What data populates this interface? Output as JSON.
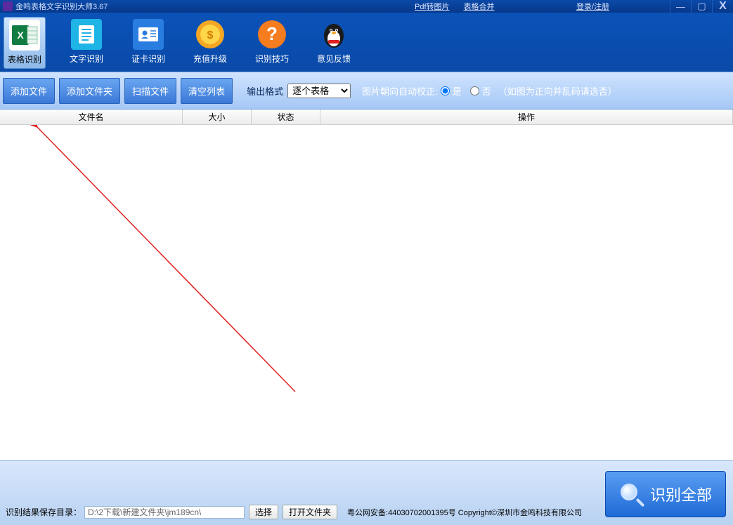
{
  "titlebar": {
    "title": "金鸣表格文字识别大师3.67",
    "links": {
      "pdf2img": "Pdf转图片",
      "merge": "表格合并",
      "login": "登录/注册"
    },
    "win": {
      "min": "—",
      "max": "▢",
      "close": "X"
    }
  },
  "main_tools": [
    {
      "label": "表格识别"
    },
    {
      "label": "文字识别"
    },
    {
      "label": "证卡识别"
    },
    {
      "label": "充值升级"
    },
    {
      "label": "识别技巧"
    },
    {
      "label": "意见反馈"
    }
  ],
  "action": {
    "add_file": "添加文件",
    "add_folder": "添加文件夹",
    "scan": "扫描文件",
    "clear": "清空列表",
    "output_label": "输出格式",
    "output_value": "逐个表格",
    "orient_label": "图片朝向自动校正:",
    "yes": "是",
    "no": "否",
    "hint": "（如图为正向并乱码请选否）"
  },
  "columns": {
    "name": "文件名",
    "size": "大小",
    "status": "状态",
    "op": "操作"
  },
  "bottom": {
    "save_label": "识别结果保存目录：",
    "save_path": "D:\\2下载\\新建文件夹\\jm189cn\\",
    "choose": "选择",
    "open_folder": "打开文件夹",
    "copyright": "粤公网安备:44030702001395号 Copyright©深圳市金鸣科技有限公司",
    "recognize_all": "识别全部"
  }
}
